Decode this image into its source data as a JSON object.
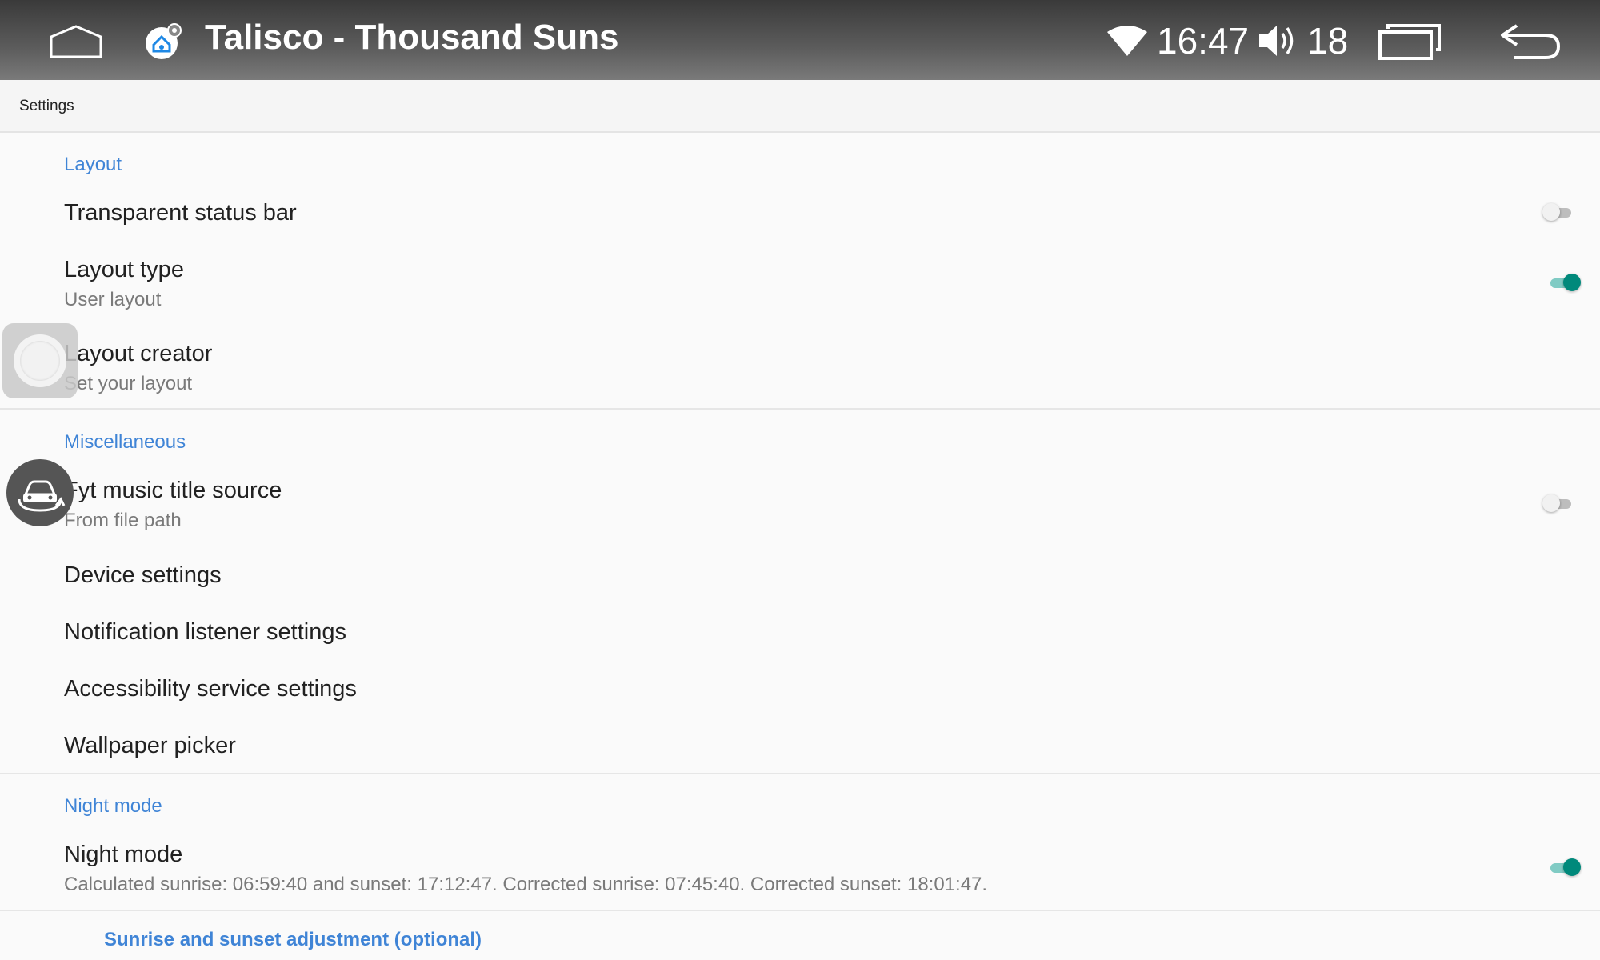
{
  "status_bar": {
    "title": "Talisco - Thousand Suns",
    "time": "16:47",
    "volume_level": "18",
    "icons": {
      "home": "home-icon",
      "app": "launcher-settings-icon",
      "wifi": "wifi-icon",
      "volume": "volume-icon",
      "recents": "recent-apps-icon",
      "back": "back-icon"
    }
  },
  "toolbar": {
    "title": "Settings"
  },
  "sections": {
    "layout": {
      "header": "Layout",
      "transparent_status_bar": {
        "title": "Transparent status bar",
        "enabled": false
      },
      "layout_type": {
        "title": "Layout type",
        "summary": "User layout",
        "enabled": true
      },
      "layout_creator": {
        "title": "Layout creator",
        "summary": "Set your layout"
      }
    },
    "misc": {
      "header": "Miscellaneous",
      "fyt_music": {
        "title": "Fyt music title source",
        "summary": "From file path",
        "enabled": false
      },
      "device_settings": {
        "title": "Device settings"
      },
      "notification_listener": {
        "title": "Notification listener settings"
      },
      "accessibility_service": {
        "title": "Accessibility service settings"
      },
      "wallpaper_picker": {
        "title": "Wallpaper picker"
      }
    },
    "night": {
      "header": "Night mode",
      "night_mode": {
        "title": "Night mode",
        "summary": "Calculated sunrise: 06:59:40 and sunset: 17:12:47. Corrected sunrise: 07:45:40. Corrected sunset: 18:01:47.",
        "enabled": true
      },
      "sunrise_adjustment_header": "Sunrise and sunset adjustment (optional)"
    }
  },
  "colors": {
    "accent": "#3f84d6",
    "switch_on": "#00897b"
  }
}
